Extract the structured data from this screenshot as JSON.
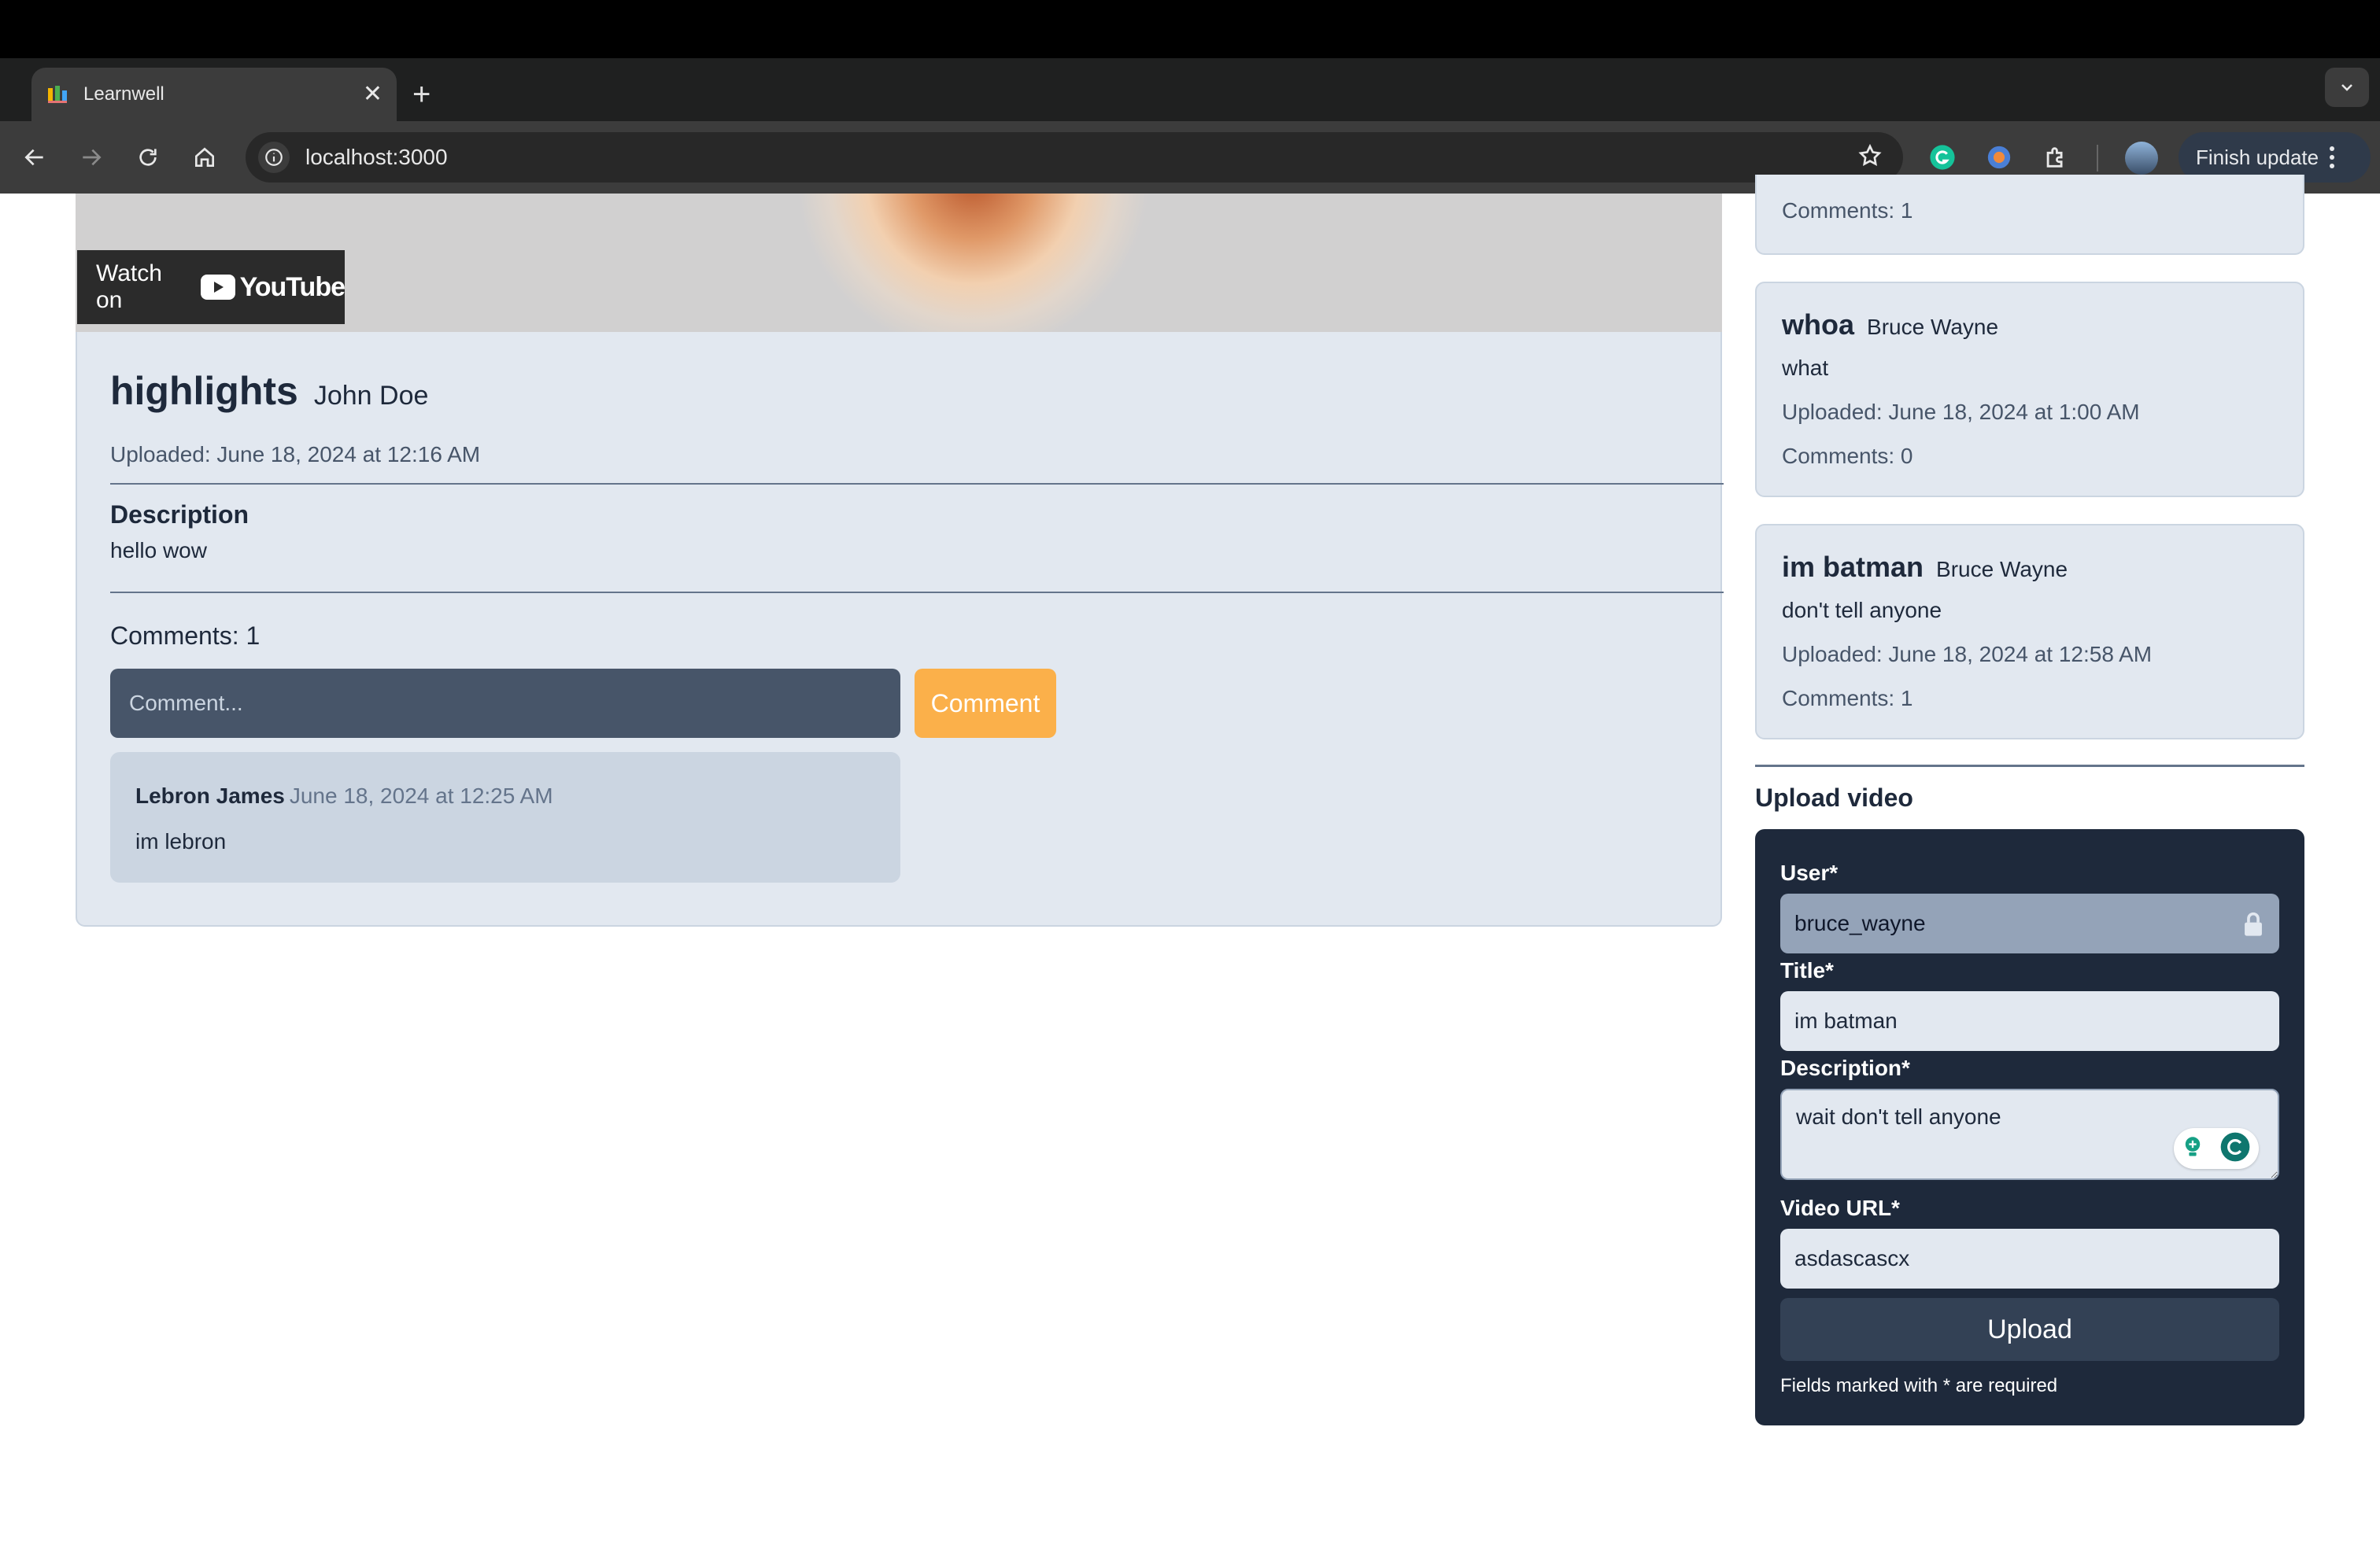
{
  "browser": {
    "tab_title": "Learnwell",
    "url": "localhost:3000",
    "finish_update_label": "Finish update"
  },
  "video": {
    "watch_on_label": "Watch on",
    "youtube_brand": "YouTube",
    "title": "highlights",
    "author": "John Doe",
    "uploaded": "Uploaded: June 18, 2024 at 12:16 AM",
    "description_heading": "Description",
    "description": "hello wow",
    "comments_count": "Comments: 1",
    "comment_placeholder": "Comment...",
    "comment_button": "Comment",
    "comments": [
      {
        "author": "Lebron James",
        "date": "June 18, 2024 at 12:25 AM",
        "text": "im lebron"
      }
    ]
  },
  "sidebar": {
    "partial_card": {
      "comments": "Comments: 1"
    },
    "videos": [
      {
        "title": "whoa",
        "author": "Bruce Wayne",
        "description": "what",
        "uploaded": "Uploaded: June 18, 2024 at 1:00 AM",
        "comments": "Comments: 0"
      },
      {
        "title": "im batman",
        "author": "Bruce Wayne",
        "description": "don't tell anyone",
        "uploaded": "Uploaded: June 18, 2024 at 12:58 AM",
        "comments": "Comments: 1"
      }
    ]
  },
  "upload": {
    "heading": "Upload video",
    "user_label": "User*",
    "user_value": "bruce_wayne",
    "title_label": "Title*",
    "title_value": "im batman",
    "description_label": "Description*",
    "description_value": "wait don't tell anyone",
    "url_label": "Video URL*",
    "url_value": "asdascascx",
    "button": "Upload",
    "note": "Fields marked with * are required"
  }
}
